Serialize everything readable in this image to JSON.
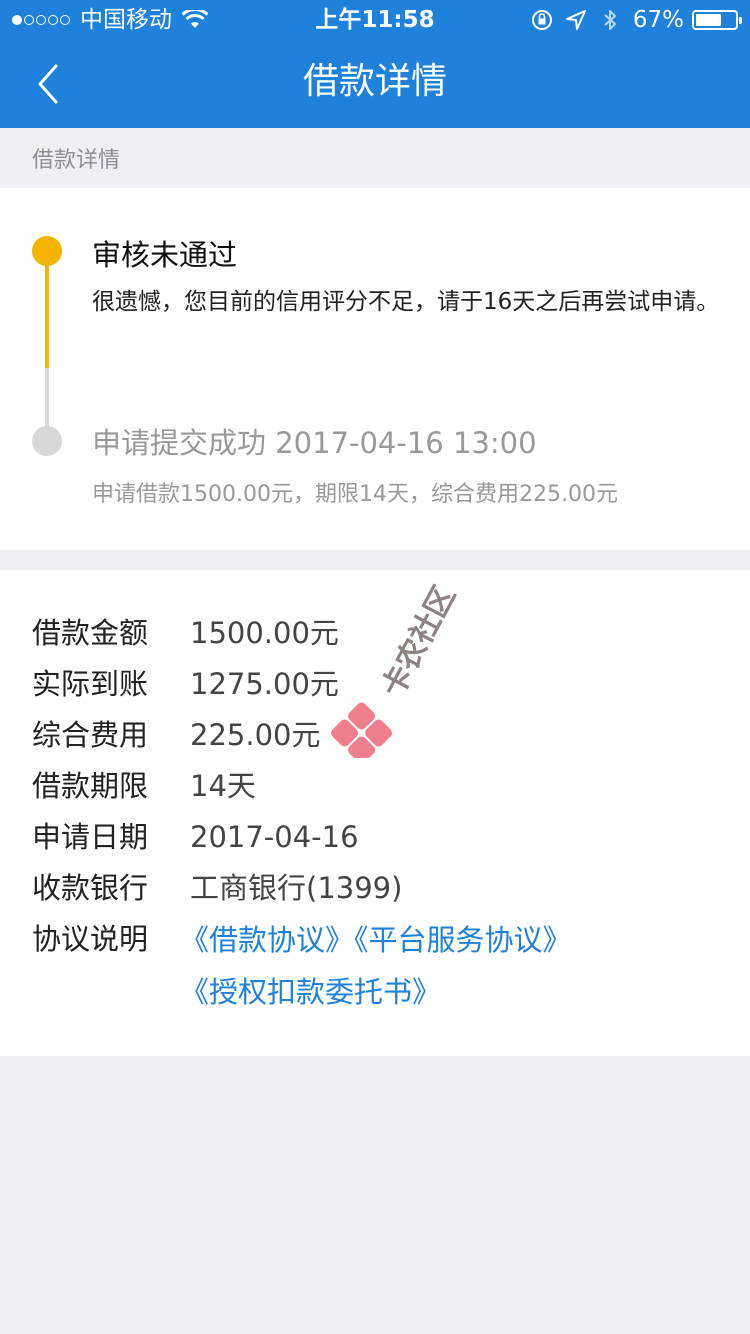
{
  "status_bar": {
    "carrier": "中国移动",
    "time": "上午11:58",
    "battery_percent": "67%",
    "battery_level": 0.67,
    "signal_bars_filled": 1,
    "signal_bars_total": 5
  },
  "nav": {
    "title": "借款详情",
    "back_icon": "chevron-left-icon"
  },
  "section_header": "借款详情",
  "timeline": {
    "steps": [
      {
        "title": "审核未通过",
        "description": "很遗憾，您目前的信用评分不足，请于16天之后再尝试申请。",
        "status_color": "#f5b400"
      },
      {
        "title": "申请提交成功 2017-04-16 13:00",
        "description": "申请借款1500.00元，期限14天，综合费用225.00元",
        "status_color": "#d8d8d8"
      }
    ]
  },
  "details": {
    "rows": [
      {
        "label": "借款金额",
        "value": "1500.00元"
      },
      {
        "label": "实际到账",
        "value": "1275.00元"
      },
      {
        "label": "综合费用",
        "value": "225.00元"
      },
      {
        "label": "借款期限",
        "value": "14天"
      },
      {
        "label": "申请日期",
        "value": "2017-04-16"
      },
      {
        "label": "收款银行",
        "value": "工商银行(1399)"
      }
    ],
    "agreement_label": "协议说明",
    "agreements": [
      "《借款协议》",
      "《平台服务协议》",
      "《授权扣款委托书》"
    ]
  },
  "watermark": {
    "text": "卡农社区",
    "icon": "kanong-logo-icon"
  },
  "colors": {
    "primary": "#1e82dc",
    "warning": "#f5b400",
    "muted": "#999999",
    "background": "#efeff4"
  }
}
